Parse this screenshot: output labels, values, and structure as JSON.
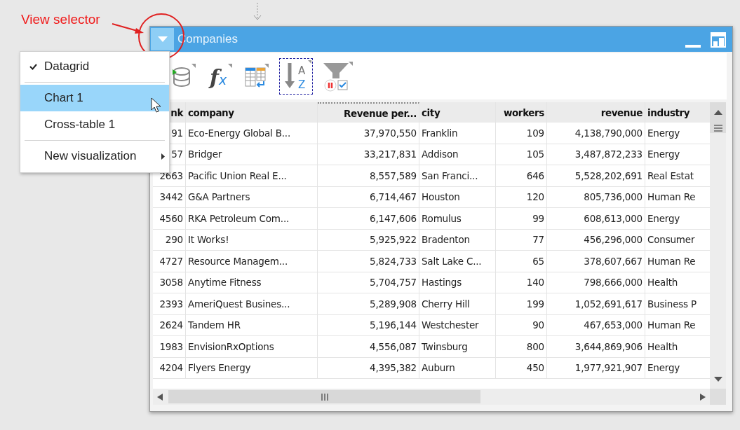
{
  "annotation": {
    "label": "View selector"
  },
  "window": {
    "title": "Companies"
  },
  "view_menu": {
    "items": [
      {
        "kind": "check",
        "label": "Datagrid",
        "checked": true,
        "selected": false
      },
      {
        "kind": "separator"
      },
      {
        "kind": "item",
        "label": "Chart 1",
        "selected": true
      },
      {
        "kind": "item",
        "label": "Cross-table 1",
        "selected": false
      },
      {
        "kind": "separator"
      },
      {
        "kind": "submenu",
        "label": "New visualization",
        "selected": false
      }
    ]
  },
  "toolbar": {
    "tools": [
      {
        "kind": "database",
        "selected": false
      },
      {
        "kind": "formula",
        "selected": false,
        "glyphs": [
          "f",
          "x"
        ]
      },
      {
        "kind": "table",
        "selected": false
      },
      {
        "kind": "sort",
        "selected": true,
        "glyphs": [
          "A",
          "Z"
        ]
      },
      {
        "kind": "filter",
        "selected": false
      }
    ]
  },
  "table": {
    "columns": [
      {
        "label": "nk"
      },
      {
        "label": "company"
      },
      {
        "label": "Revenue per..."
      },
      {
        "label": "city"
      },
      {
        "label": "workers"
      },
      {
        "label": "revenue"
      },
      {
        "label": "industry"
      }
    ],
    "rows": [
      {
        "cells": [
          "91",
          "Eco-Energy Global B...",
          "37,970,550",
          "Franklin",
          "109",
          "4,138,790,000",
          "Energy"
        ]
      },
      {
        "cells": [
          "57",
          "Bridger",
          "33,217,831",
          "Addison",
          "105",
          "3,487,872,233",
          "Energy"
        ]
      },
      {
        "cells": [
          "2663",
          "Pacific Union Real E...",
          "8,557,589",
          "San Franci...",
          "646",
          "5,528,202,691",
          "Real Estat"
        ]
      },
      {
        "cells": [
          "3442",
          "G&A Partners",
          "6,714,467",
          "Houston",
          "120",
          "805,736,000",
          "Human Re"
        ]
      },
      {
        "cells": [
          "4560",
          "RKA Petroleum Com...",
          "6,147,606",
          "Romulus",
          "99",
          "608,613,000",
          "Energy"
        ]
      },
      {
        "cells": [
          "290",
          "It Works!",
          "5,925,922",
          "Bradenton",
          "77",
          "456,296,000",
          "Consumer"
        ]
      },
      {
        "cells": [
          "4727",
          "Resource Managem...",
          "5,824,733",
          "Salt Lake C...",
          "65",
          "378,607,667",
          "Human Re"
        ]
      },
      {
        "cells": [
          "3058",
          "Anytime Fitness",
          "5,704,757",
          "Hastings",
          "140",
          "798,666,000",
          "Health"
        ]
      },
      {
        "cells": [
          "2393",
          "AmeriQuest Busines...",
          "5,289,908",
          "Cherry Hill",
          "199",
          "1,052,691,617",
          "Business P"
        ]
      },
      {
        "cells": [
          "2624",
          "Tandem HR",
          "5,196,144",
          "Westchester",
          "90",
          "467,653,000",
          "Human Re"
        ]
      },
      {
        "cells": [
          "1983",
          "EnvisionRxOptions",
          "4,556,087",
          "Twinsburg",
          "800",
          "3,644,869,906",
          "Health"
        ]
      },
      {
        "cells": [
          "4204",
          "Flyers Energy",
          "4,395,382",
          "Auburn",
          "450",
          "1,977,921,907",
          "Energy"
        ]
      }
    ]
  }
}
